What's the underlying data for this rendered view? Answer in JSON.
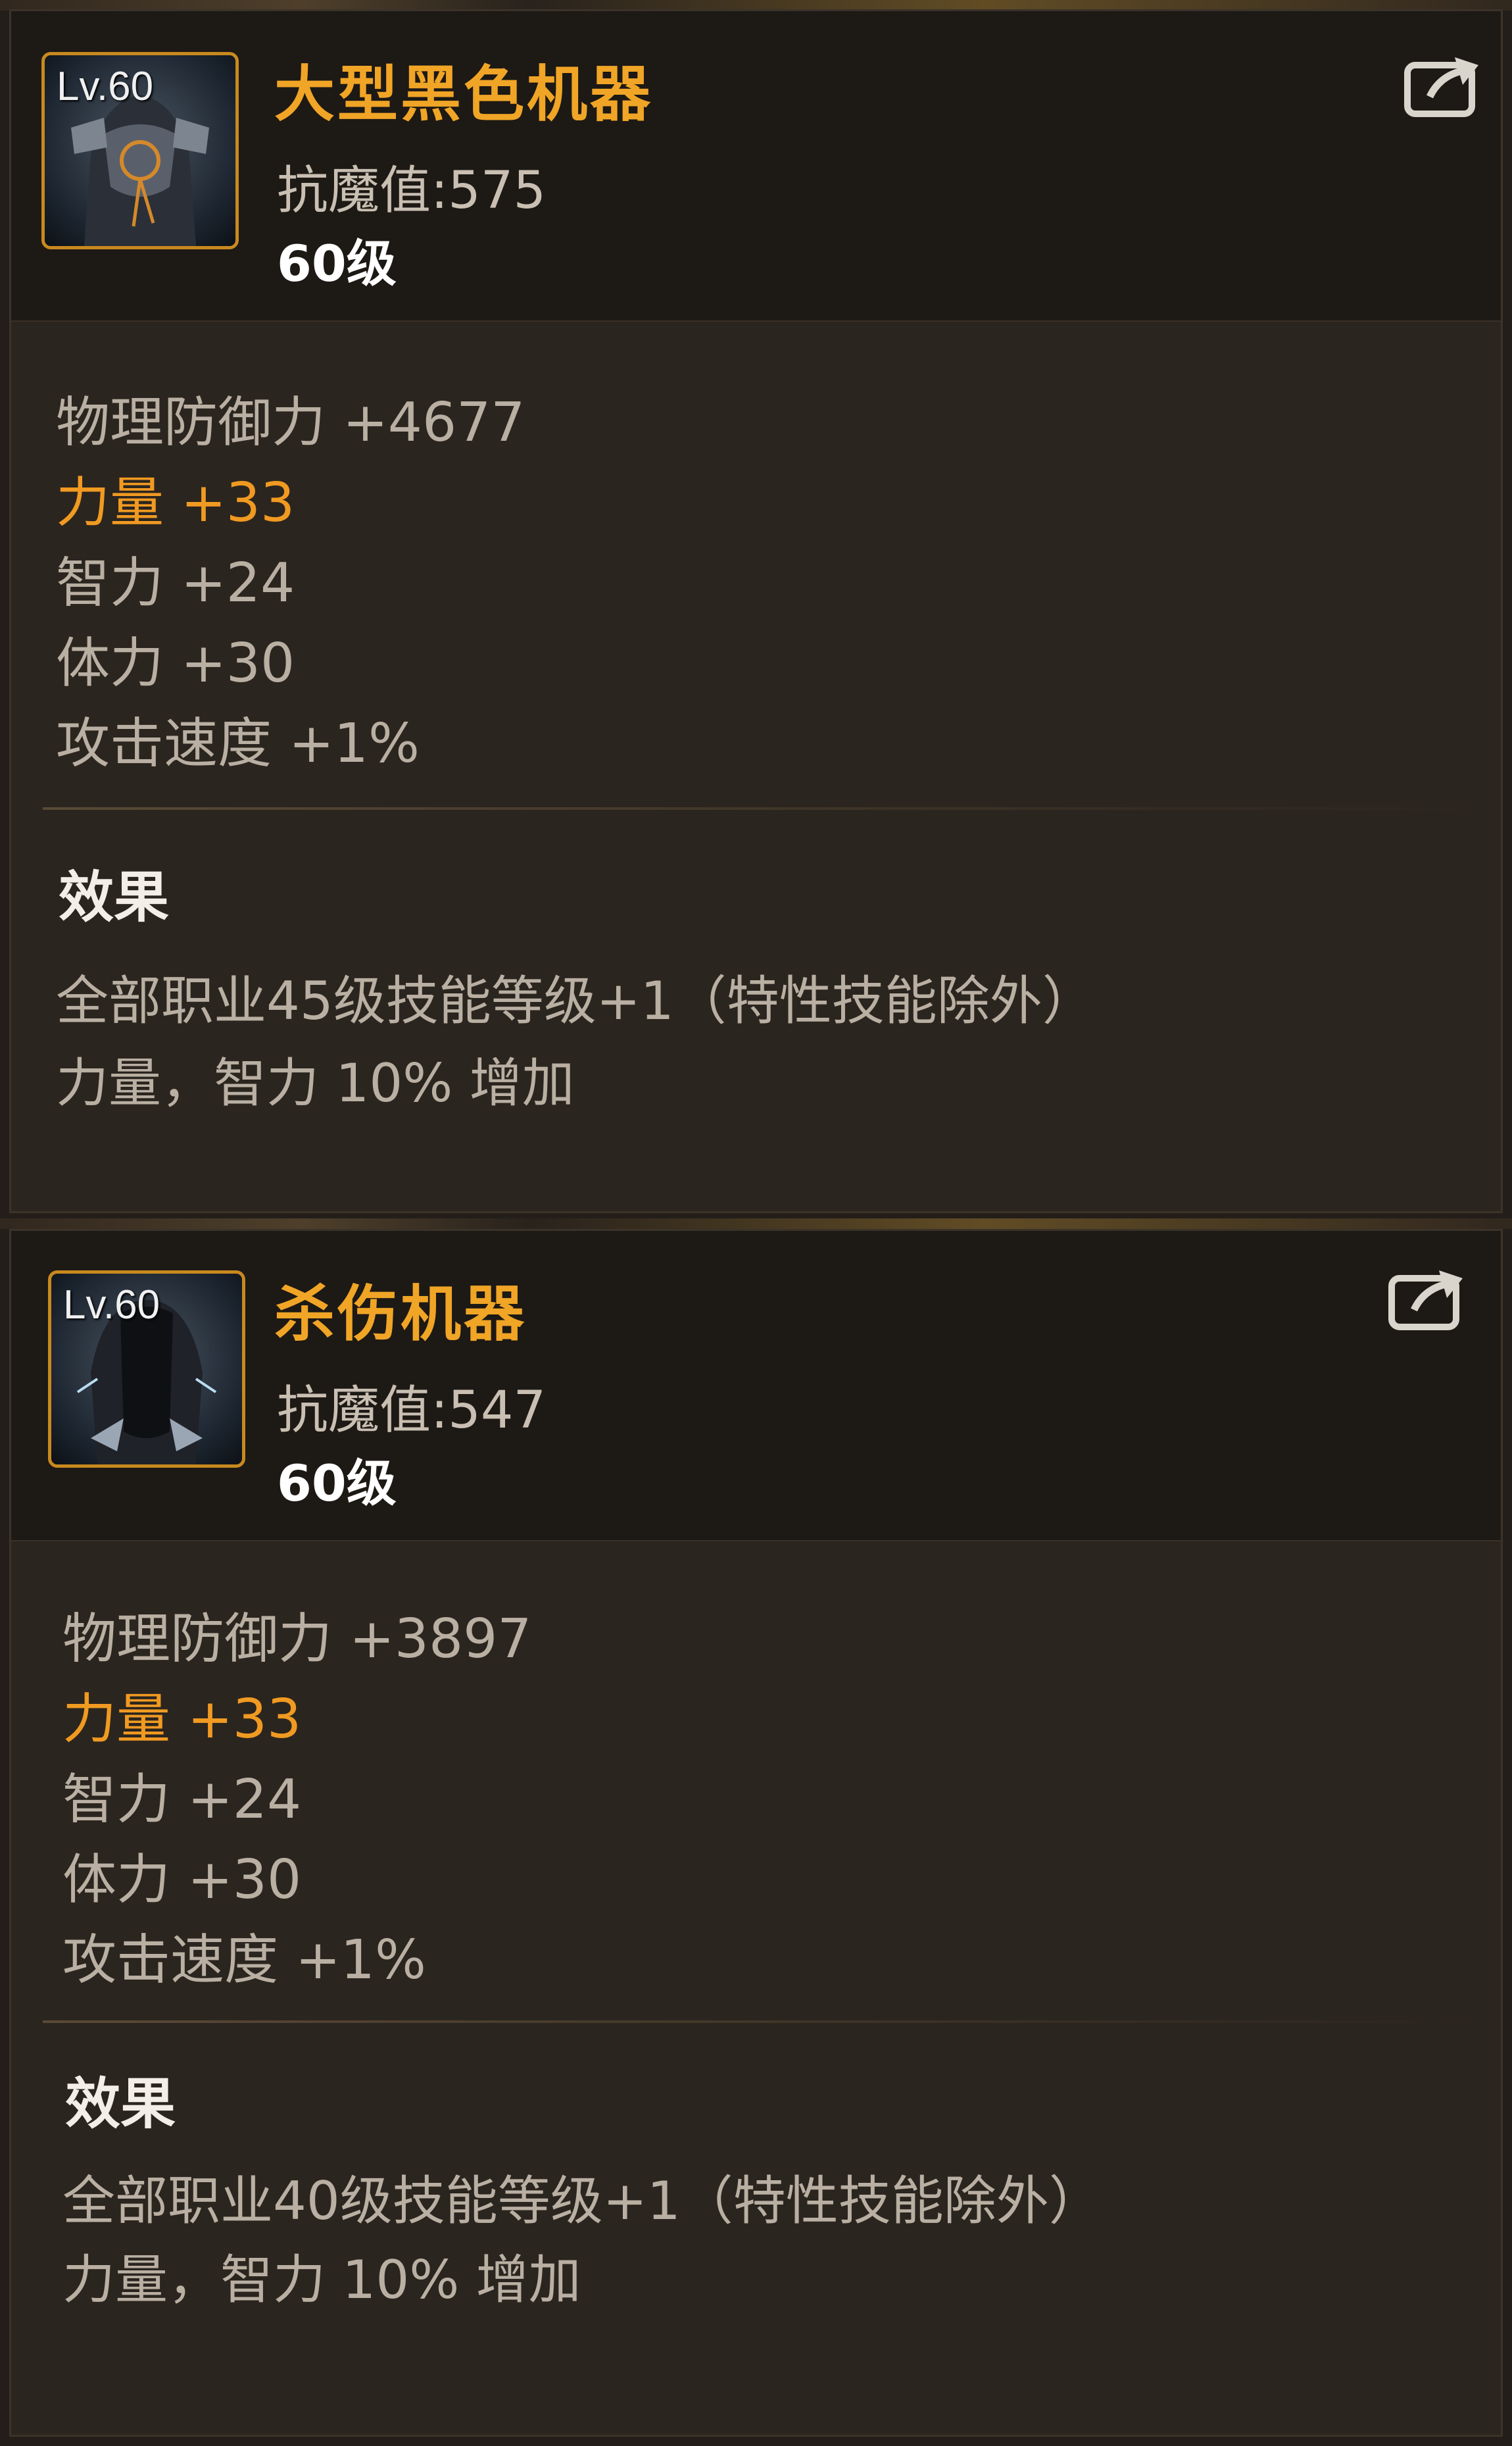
{
  "items": [
    {
      "lv_badge": "Lv.60",
      "name": "大型黑色机器",
      "resist": "抗魔值:575",
      "level": "60级",
      "stats": {
        "phys_def": "物理防御力 +4677",
        "strength": "力量 +33",
        "intelligence": "智力 +24",
        "vitality": "体力 +30",
        "atk_speed": "攻击速度 +1%"
      },
      "effect_title": "效果",
      "effect_lines": [
        "全部职业45级技能等级+1（特性技能除外）",
        "力量，智力 10% 增加"
      ]
    },
    {
      "lv_badge": "Lv.60",
      "name": "杀伤机器",
      "resist": "抗魔值:547",
      "level": "60级",
      "stats": {
        "phys_def": "物理防御力 +3897",
        "strength": "力量 +33",
        "intelligence": "智力 +24",
        "vitality": "体力 +30",
        "atk_speed": "攻击速度 +1%"
      },
      "effect_title": "效果",
      "effect_lines": [
        "全部职业40级技能等级+1（特性技能除外）",
        "力量，智力 10% 增加"
      ]
    }
  ],
  "colors": {
    "name": "#f0a526",
    "highlight_stat": "#f09a22",
    "normal_stat": "#b9afa2",
    "frame": "#c8891f"
  },
  "icons": {
    "share": "share-export-icon",
    "item_top": "black-machine-armor-icon",
    "item_bottom": "killing-machine-armor-icon"
  }
}
